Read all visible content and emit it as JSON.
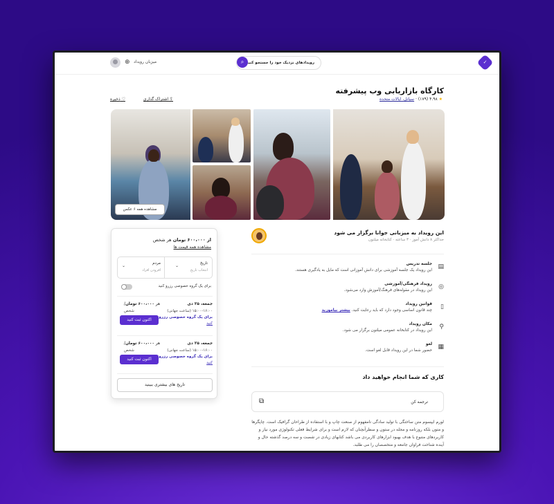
{
  "header": {
    "search_placeholder": "رویدادهای نزدیک خود را جستجو کنید",
    "host_link": "میزبان رویداد"
  },
  "event": {
    "title": "کارگاه بازاریابی وب پیشرفته",
    "rating": "۴.۹۸",
    "reviews": "(۱۷۹)",
    "location": "سیاتل، ایالات متحده",
    "share_label": "اشتراک گذاری",
    "save_label": "ذخیره",
    "show_all_photos": "مشاهده همه ۶ عکس"
  },
  "host": {
    "title": "این رویداد به میزبانی جوانا برگزار می شود",
    "subtitle": "حداکثر ۸ دانش آموز · ۳ ساعته · کتابخانه میلتون"
  },
  "features": [
    {
      "icon": "chalkboard-icon",
      "title": "جلسه تدریس",
      "desc": "این رویداد یک جلسه آموزشی برای دانش آموزانی است که مایل به یادگیری هستند."
    },
    {
      "icon": "palette-icon",
      "title": "رویداد فرهنگی/آموزشی",
      "desc": "این رویداد در مقوله‌های فرهنگ/آموزش وارد می‌شود."
    },
    {
      "icon": "book-icon",
      "title": "قوانین رویداد",
      "desc": "چند قانون اساسی وجود دارد که باید رعایت کنید.",
      "link": "بیشتر بیاموزید"
    },
    {
      "icon": "location-pin-icon",
      "title": "مکان رویداد",
      "desc": "این رویداد در کتابخانه عمومی میلتون برگزار می شود."
    },
    {
      "icon": "calendar-icon",
      "title": "لغو",
      "desc": "حضور شما در این رویداد قابل لغو است."
    }
  ],
  "activities": {
    "title": "کاری که شما انجام خواهید داد",
    "task_label": "ترجمه کن",
    "lorem": "لورم ایپسوم متن ساختگی با تولید سادگی نامفهوم از صنعت چاپ و با استفاده از طراحان گرافیک است. چاپگرها و متون بلکه روزنامه و مجله در ستون و سطرآنچنان که لازم است و برای شرایط فعلی تکنولوژی مورد نیاز و کاربردهای متنوع با هدف بهبود ابزارهای کاربردی می باشد کتابهای زیادی در شصت و سه درصد گذشته حال و آینده شناخت فراوان جامعه و متخصصان را می طلبد."
  },
  "booking": {
    "price_from": "از ۶۰۰،۰۰۰ تومان",
    "price_per": "هر شخص",
    "all_prices": "مشاهده همه قیمت ها",
    "date_label": "تاریخ",
    "date_placeholder": "انتخاب تاریخ",
    "guests_label": "مردم",
    "guests_placeholder": "افزودن افراد",
    "private_toggle": "برای یک گروه خصوصی رزرو کنید",
    "slots": [
      {
        "date": "جمعه، ۲۵ دی",
        "time": "۱۵:۰۰-۱۶:۰۰ (ساعت جهانی)",
        "group_line1": "برای یک گروه خصوصی رزرو",
        "group_line2": "کنید",
        "price": "۶۰۰،۰۰۰ تومان",
        "per": "/هر",
        "per2": "شخص",
        "button": "اکنون ثبت کنید"
      },
      {
        "date": "جمعه، ۲۵ دی",
        "time": "۱۵:۰۰-۱۶:۰۰ (ساعت جهانی)",
        "group_line1": "برای یک گروه خصوصی رزرو",
        "group_line2": "کنید",
        "price": "۶۰۰،۰۰۰ تومان",
        "per": "/هر",
        "per2": "شخص",
        "button": "اکنون ثبت کنید"
      }
    ],
    "more_dates": "تاریخ های بیشتری ببینید"
  }
}
